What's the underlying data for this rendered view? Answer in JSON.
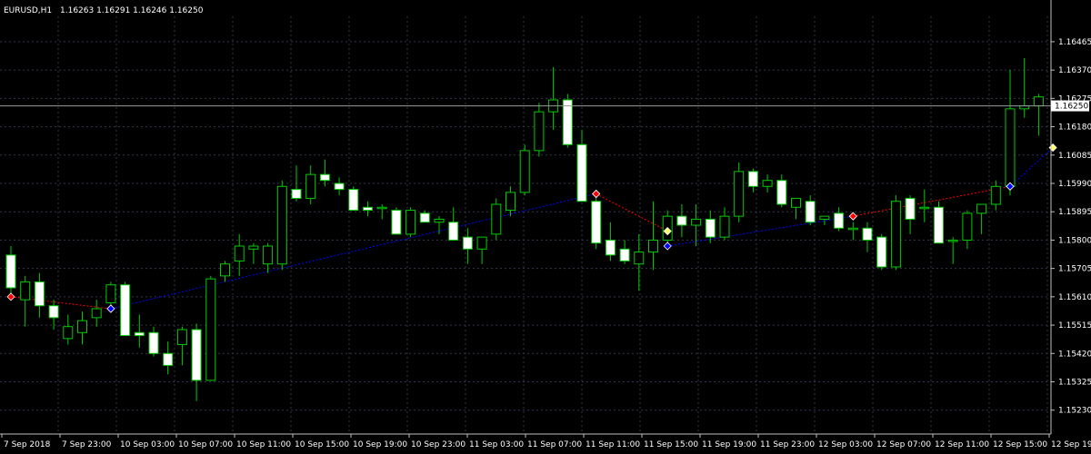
{
  "header": {
    "symbol": "EURUSD,H1",
    "ohlc": "1.16263 1.16291 1.16246 1.16250"
  },
  "colors": {
    "background": "#000000",
    "grid": "#34384a",
    "axis": "#c0c0c0",
    "bull_wick": "#00cc00",
    "bull_body": "#000000",
    "bear_body": "#ffffff",
    "bear_wick": "#00cc00",
    "price_line": "#9a9a9a",
    "trade_up_line": "#0000ff",
    "trade_down_line": "#ff0000",
    "text": "#ffffff"
  },
  "price_label": "1.16250",
  "chart_data": {
    "type": "candlestick",
    "ylim": [
      1.1515,
      1.1655
    ],
    "y_ticks": [
      "1.16465",
      "1.16370",
      "1.16275",
      "1.16180",
      "1.16085",
      "1.15990",
      "1.15895",
      "1.15800",
      "1.15705",
      "1.15610",
      "1.15515",
      "1.15420",
      "1.15325",
      "1.15230"
    ],
    "x_ticks": [
      "7 Sep 2018",
      "7 Sep 23:00",
      "10 Sep 03:00",
      "10 Sep 07:00",
      "10 Sep 11:00",
      "10 Sep 15:00",
      "10 Sep 19:00",
      "10 Sep 23:00",
      "11 Sep 03:00",
      "11 Sep 07:00",
      "11 Sep 11:00",
      "11 Sep 15:00",
      "11 Sep 19:00",
      "11 Sep 23:00",
      "12 Sep 03:00",
      "12 Sep 07:00",
      "12 Sep 11:00",
      "12 Sep 15:00",
      "12 Sep 19"
    ],
    "current_price": 1.1625,
    "candles": [
      {
        "o": 1.1575,
        "h": 1.1578,
        "l": 1.1562,
        "c": 1.1564
      },
      {
        "o": 1.156,
        "h": 1.1568,
        "l": 1.1551,
        "c": 1.1566
      },
      {
        "o": 1.1566,
        "h": 1.1569,
        "l": 1.1554,
        "c": 1.1558
      },
      {
        "o": 1.1558,
        "h": 1.156,
        "l": 1.155,
        "c": 1.1554
      },
      {
        "o": 1.1547,
        "h": 1.1555,
        "l": 1.1545,
        "c": 1.1551
      },
      {
        "o": 1.1549,
        "h": 1.1556,
        "l": 1.1545,
        "c": 1.1553
      },
      {
        "o": 1.1554,
        "h": 1.156,
        "l": 1.1551,
        "c": 1.1557
      },
      {
        "o": 1.1559,
        "h": 1.1566,
        "l": 1.1556,
        "c": 1.1565
      },
      {
        "o": 1.1565,
        "h": 1.1566,
        "l": 1.1548,
        "c": 1.1548
      },
      {
        "o": 1.1549,
        "h": 1.1555,
        "l": 1.1544,
        "c": 1.1548
      },
      {
        "o": 1.1549,
        "h": 1.1551,
        "l": 1.1541,
        "c": 1.1542
      },
      {
        "o": 1.1542,
        "h": 1.1546,
        "l": 1.1535,
        "c": 1.1538
      },
      {
        "o": 1.1545,
        "h": 1.1551,
        "l": 1.1538,
        "c": 1.155
      },
      {
        "o": 1.155,
        "h": 1.1552,
        "l": 1.1526,
        "c": 1.1533
      },
      {
        "o": 1.1533,
        "h": 1.1568,
        "l": 1.1533,
        "c": 1.1567
      },
      {
        "o": 1.1568,
        "h": 1.1573,
        "l": 1.1566,
        "c": 1.1572
      },
      {
        "o": 1.1573,
        "h": 1.1582,
        "l": 1.1568,
        "c": 1.1578
      },
      {
        "o": 1.1577,
        "h": 1.1579,
        "l": 1.1572,
        "c": 1.1578
      },
      {
        "o": 1.1572,
        "h": 1.1579,
        "l": 1.1569,
        "c": 1.1578
      },
      {
        "o": 1.1572,
        "h": 1.16,
        "l": 1.157,
        "c": 1.1598
      },
      {
        "o": 1.1597,
        "h": 1.1605,
        "l": 1.1593,
        "c": 1.1594
      },
      {
        "o": 1.1594,
        "h": 1.1605,
        "l": 1.1592,
        "c": 1.1602
      },
      {
        "o": 1.1602,
        "h": 1.1607,
        "l": 1.1598,
        "c": 1.16
      },
      {
        "o": 1.1599,
        "h": 1.1601,
        "l": 1.1595,
        "c": 1.1597
      },
      {
        "o": 1.1597,
        "h": 1.1598,
        "l": 1.159,
        "c": 1.159
      },
      {
        "o": 1.1591,
        "h": 1.1593,
        "l": 1.1588,
        "c": 1.159
      },
      {
        "o": 1.1591,
        "h": 1.1592,
        "l": 1.1587,
        "c": 1.1591
      },
      {
        "o": 1.159,
        "h": 1.1591,
        "l": 1.1582,
        "c": 1.1582
      },
      {
        "o": 1.1582,
        "h": 1.1591,
        "l": 1.1581,
        "c": 1.159
      },
      {
        "o": 1.1589,
        "h": 1.159,
        "l": 1.1586,
        "c": 1.1586
      },
      {
        "o": 1.1586,
        "h": 1.1588,
        "l": 1.1582,
        "c": 1.1587
      },
      {
        "o": 1.1586,
        "h": 1.1591,
        "l": 1.158,
        "c": 1.158
      },
      {
        "o": 1.1581,
        "h": 1.1584,
        "l": 1.1572,
        "c": 1.1577
      },
      {
        "o": 1.1577,
        "h": 1.1581,
        "l": 1.1572,
        "c": 1.1581
      },
      {
        "o": 1.1582,
        "h": 1.1594,
        "l": 1.158,
        "c": 1.1592
      },
      {
        "o": 1.159,
        "h": 1.1598,
        "l": 1.1588,
        "c": 1.1596
      },
      {
        "o": 1.1596,
        "h": 1.1612,
        "l": 1.1595,
        "c": 1.161
      },
      {
        "o": 1.161,
        "h": 1.1626,
        "l": 1.1608,
        "c": 1.1623
      },
      {
        "o": 1.1623,
        "h": 1.1638,
        "l": 1.1617,
        "c": 1.1627
      },
      {
        "o": 1.1627,
        "h": 1.1629,
        "l": 1.1611,
        "c": 1.1612
      },
      {
        "o": 1.1612,
        "h": 1.1617,
        "l": 1.1593,
        "c": 1.1593
      },
      {
        "o": 1.1593,
        "h": 1.1595,
        "l": 1.1577,
        "c": 1.1579
      },
      {
        "o": 1.158,
        "h": 1.1586,
        "l": 1.1573,
        "c": 1.1575
      },
      {
        "o": 1.1577,
        "h": 1.158,
        "l": 1.1572,
        "c": 1.1573
      },
      {
        "o": 1.1572,
        "h": 1.1582,
        "l": 1.1563,
        "c": 1.1576
      },
      {
        "o": 1.1576,
        "h": 1.1593,
        "l": 1.157,
        "c": 1.158
      },
      {
        "o": 1.158,
        "h": 1.159,
        "l": 1.1578,
        "c": 1.1588
      },
      {
        "o": 1.1588,
        "h": 1.1592,
        "l": 1.1581,
        "c": 1.1585
      },
      {
        "o": 1.1585,
        "h": 1.1592,
        "l": 1.1578,
        "c": 1.1587
      },
      {
        "o": 1.1587,
        "h": 1.159,
        "l": 1.1579,
        "c": 1.1581
      },
      {
        "o": 1.1581,
        "h": 1.1591,
        "l": 1.158,
        "c": 1.1588
      },
      {
        "o": 1.1588,
        "h": 1.1606,
        "l": 1.1586,
        "c": 1.1603
      },
      {
        "o": 1.1603,
        "h": 1.1604,
        "l": 1.1596,
        "c": 1.1598
      },
      {
        "o": 1.1598,
        "h": 1.1602,
        "l": 1.1596,
        "c": 1.16
      },
      {
        "o": 1.16,
        "h": 1.1602,
        "l": 1.1591,
        "c": 1.1592
      },
      {
        "o": 1.1591,
        "h": 1.1594,
        "l": 1.1587,
        "c": 1.1594
      },
      {
        "o": 1.1593,
        "h": 1.1595,
        "l": 1.1585,
        "c": 1.1586
      },
      {
        "o": 1.1587,
        "h": 1.1588,
        "l": 1.1585,
        "c": 1.1588
      },
      {
        "o": 1.1589,
        "h": 1.1591,
        "l": 1.1583,
        "c": 1.1584
      },
      {
        "o": 1.1584,
        "h": 1.1586,
        "l": 1.158,
        "c": 1.1584
      },
      {
        "o": 1.1584,
        "h": 1.1586,
        "l": 1.1576,
        "c": 1.158
      },
      {
        "o": 1.1581,
        "h": 1.1582,
        "l": 1.157,
        "c": 1.1571
      },
      {
        "o": 1.1571,
        "h": 1.1595,
        "l": 1.157,
        "c": 1.1593
      },
      {
        "o": 1.1594,
        "h": 1.1595,
        "l": 1.1582,
        "c": 1.1587
      },
      {
        "o": 1.1591,
        "h": 1.1597,
        "l": 1.1586,
        "c": 1.1591
      },
      {
        "o": 1.1591,
        "h": 1.1593,
        "l": 1.1579,
        "c": 1.1579
      },
      {
        "o": 1.158,
        "h": 1.1581,
        "l": 1.1572,
        "c": 1.158
      },
      {
        "o": 1.158,
        "h": 1.159,
        "l": 1.1577,
        "c": 1.1589
      },
      {
        "o": 1.1589,
        "h": 1.1592,
        "l": 1.1582,
        "c": 1.1592
      },
      {
        "o": 1.1592,
        "h": 1.16,
        "l": 1.159,
        "c": 1.1598
      },
      {
        "o": 1.1598,
        "h": 1.1637,
        "l": 1.1595,
        "c": 1.1624
      },
      {
        "o": 1.1624,
        "h": 1.1641,
        "l": 1.1621,
        "c": 1.1625
      },
      {
        "o": 1.1625,
        "h": 1.1629,
        "l": 1.1615,
        "c": 1.1628
      }
    ],
    "trades": [
      {
        "i0": 0,
        "p0": 1.1561,
        "i1": 7,
        "p1": 1.1557,
        "color": "down"
      },
      {
        "i0": 7,
        "p0": 1.1557,
        "i1": 41,
        "p1": 1.15955,
        "color": "up"
      },
      {
        "i0": 41,
        "p0": 1.15955,
        "i1": 46,
        "p1": 1.1583,
        "color": "down"
      },
      {
        "i0": 46,
        "p0": 1.1578,
        "i1": 59,
        "p1": 1.1588,
        "color": "up"
      },
      {
        "i0": 59,
        "p0": 1.1588,
        "i1": 70,
        "p1": 1.1598,
        "color": "down"
      },
      {
        "i0": 70,
        "p0": 1.1598,
        "i1": 73,
        "p1": 1.1611,
        "color": "up"
      }
    ]
  }
}
